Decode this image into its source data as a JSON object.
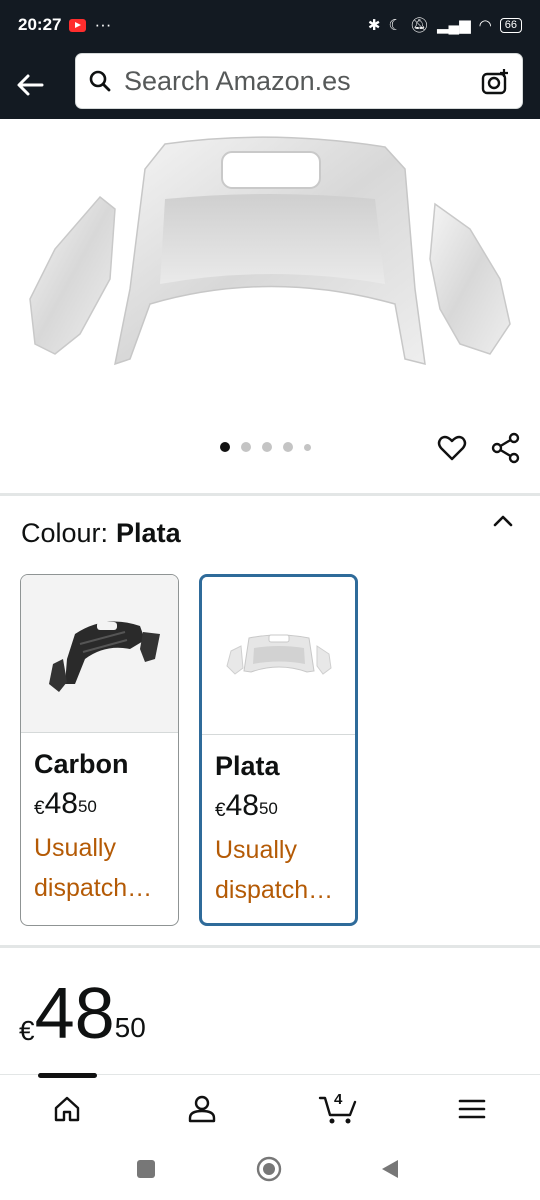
{
  "status_bar": {
    "time": "20:27",
    "dots": "···",
    "battery": "66"
  },
  "search": {
    "placeholder": "Search Amazon.es"
  },
  "gallery": {
    "image_count": 5,
    "active_index": 0
  },
  "variation": {
    "label": "Colour:",
    "selected": "Plata",
    "options": [
      {
        "name": "Carbon",
        "currency": "€",
        "whole": "48",
        "fraction": "50",
        "availability_line1": "Usually",
        "availability_line2": "dispatch…",
        "selected": false
      },
      {
        "name": "Plata",
        "currency": "€",
        "whole": "48",
        "fraction": "50",
        "availability_line1": "Usually",
        "availability_line2": "dispatch…",
        "selected": true
      }
    ]
  },
  "price": {
    "currency": "€",
    "whole": "48",
    "fraction": "50"
  },
  "bottom_nav": {
    "cart_count": "4",
    "items": [
      "home-icon",
      "account-icon",
      "cart-icon",
      "menu-icon"
    ]
  },
  "colors": {
    "header_bg": "#131a22",
    "availability": "#b45a05",
    "selected_border": "#2f6b9a"
  }
}
